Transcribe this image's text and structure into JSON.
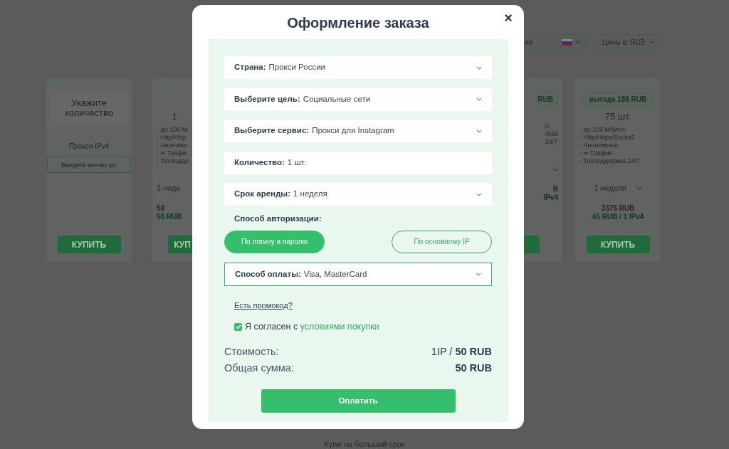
{
  "background": {
    "selects": [
      {
        "text": "ии",
        "flag": true
      },
      {
        "text": "Цены в: RUB",
        "flag": false
      }
    ],
    "cards": [
      {
        "kind": "custom",
        "title": "Укажите количество",
        "subtitle": "Прокси IPv4",
        "placeholder": "Введите кол-во шт",
        "button": "КУПИТЬ"
      },
      {
        "kind": "clip_left",
        "count": "1",
        "features": [
          "- до 100 М",
          "- Http/Http",
          {
            "before": "- Анонимн"
          },
          {
            "before": "- ",
            "mark": "∞",
            "after": " Трафи"
          },
          "- Техподде"
        ],
        "period": "1 неде",
        "price": "50",
        "unit_price": "50 RUB",
        "button": "КУП"
      },
      {
        "kind": "clip_right",
        "badge": "RUB",
        "features": [
          "/с",
          "cks5",
          "24/7"
        ],
        "price": "B",
        "unit_price": "IPv4"
      },
      {
        "kind": "full",
        "badge": "выгода 188 RUB",
        "count": "75 шт.",
        "features": [
          "- до 100 Мбит/с",
          "- Http/Https/Socks5",
          "- Анонимные",
          {
            "before": "- ",
            "mark": "∞",
            "after": " Трафик"
          },
          "- Техподдержка 24/7"
        ],
        "period": "1 неделя",
        "price": "3375 RUB",
        "unit_price": "45 RUB / 1 IPv4",
        "button": "КУПИТЬ"
      }
    ],
    "footer": {
      "subtitle": "Купи на больший срок"
    }
  },
  "modal": {
    "title": "Оформление заказа",
    "close": "×",
    "fields": [
      {
        "kind": "select",
        "label": "Страна:",
        "value": "Прокси России"
      },
      {
        "kind": "select",
        "label": "Выберите цель:",
        "value": "Социальные сети"
      },
      {
        "kind": "select",
        "label": "Выберите сервис:",
        "value": "Прокси для Instagram"
      },
      {
        "kind": "text",
        "label": "Количество:",
        "value": "1 шт."
      },
      {
        "kind": "select",
        "label": "Срок аренды:",
        "value": "1 неделя"
      }
    ],
    "auth": {
      "label": "Способ авторизации:",
      "options": [
        {
          "label": "По логину и паролю",
          "selected": true
        },
        {
          "label": "По основному IP",
          "selected": false
        }
      ]
    },
    "payment": {
      "label": "Способ оплаты:",
      "value": "Visa, MasterCard",
      "focused": true
    },
    "promo_link": "Есть промокод?",
    "agreement": {
      "checked": true,
      "text": "Я согласен с",
      "link": "условиями покупки"
    },
    "totals": [
      {
        "label": "Стоимость:",
        "value": "1IP / **50 RUB**",
        "bold": false
      },
      {
        "label": "Общая сумма:",
        "value": "50 RUB",
        "bold": true
      }
    ],
    "pay_button": "Оплатить"
  }
}
